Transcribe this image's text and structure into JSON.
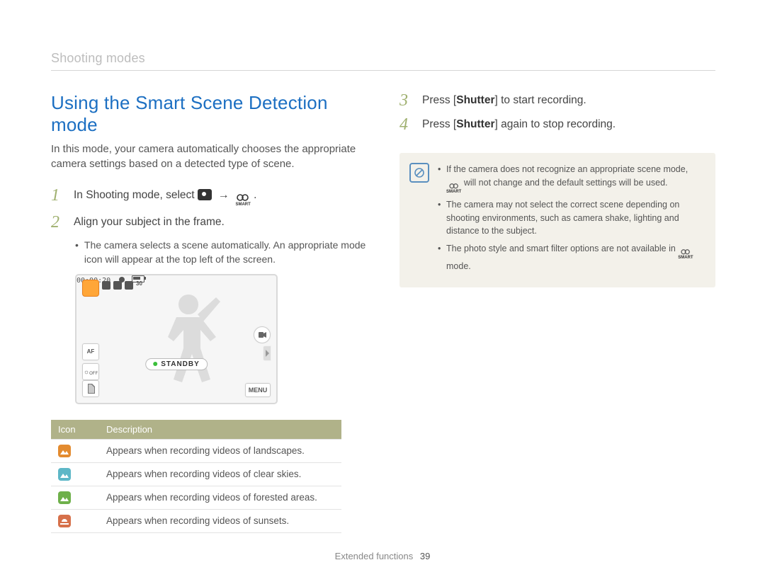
{
  "header": {
    "breadcrumb": "Shooting modes"
  },
  "section": {
    "title": "Using the Smart Scene Detection mode",
    "intro": "In this mode, your camera automatically chooses the appropriate camera settings based on a detected type of scene."
  },
  "steps": [
    {
      "n": "1",
      "text_pre": "In Shooting mode, select ",
      "text_post": " ."
    },
    {
      "n": "2",
      "text": "Align your subject in the frame."
    },
    {
      "n": "3",
      "text_pre": "Press [",
      "bold": "Shutter",
      "text_post": "] to start recording."
    },
    {
      "n": "4",
      "text_pre": "Press [",
      "bold": "Shutter",
      "text_post": "] again to stop recording."
    }
  ],
  "sub_bullet_step2": "The camera selects a scene automatically. An appropriate mode icon will appear at the top left of the screen.",
  "lcd": {
    "timecode": "00:00:20",
    "standby": "STANDBY",
    "af": "AF",
    "off": "OFF",
    "menu": "MENU",
    "grid": "30"
  },
  "table": {
    "head_icon": "Icon",
    "head_desc": "Description",
    "rows": [
      {
        "icon": "landscape",
        "color": "c-orange",
        "desc": "Appears when recording videos of landscapes."
      },
      {
        "icon": "sky",
        "color": "c-cyan",
        "desc": "Appears when recording videos of clear skies."
      },
      {
        "icon": "forest",
        "color": "c-green",
        "desc": "Appears when recording videos of forested areas."
      },
      {
        "icon": "sunset",
        "color": "c-red",
        "desc": "Appears when recording videos of sunsets."
      }
    ]
  },
  "notes": {
    "items": [
      {
        "pre": "If the camera does not recognize an appropriate scene mode, ",
        "post": " will not change and the default settings will be used."
      },
      {
        "pre": "The camera may not select the correct scene depending on shooting environments, such as camera shake, lighting and distance to the subject.",
        "post": ""
      },
      {
        "pre": "The photo style and smart filter options are not available in ",
        "post": " mode."
      }
    ]
  },
  "footer": {
    "section": "Extended functions",
    "page": "39"
  }
}
